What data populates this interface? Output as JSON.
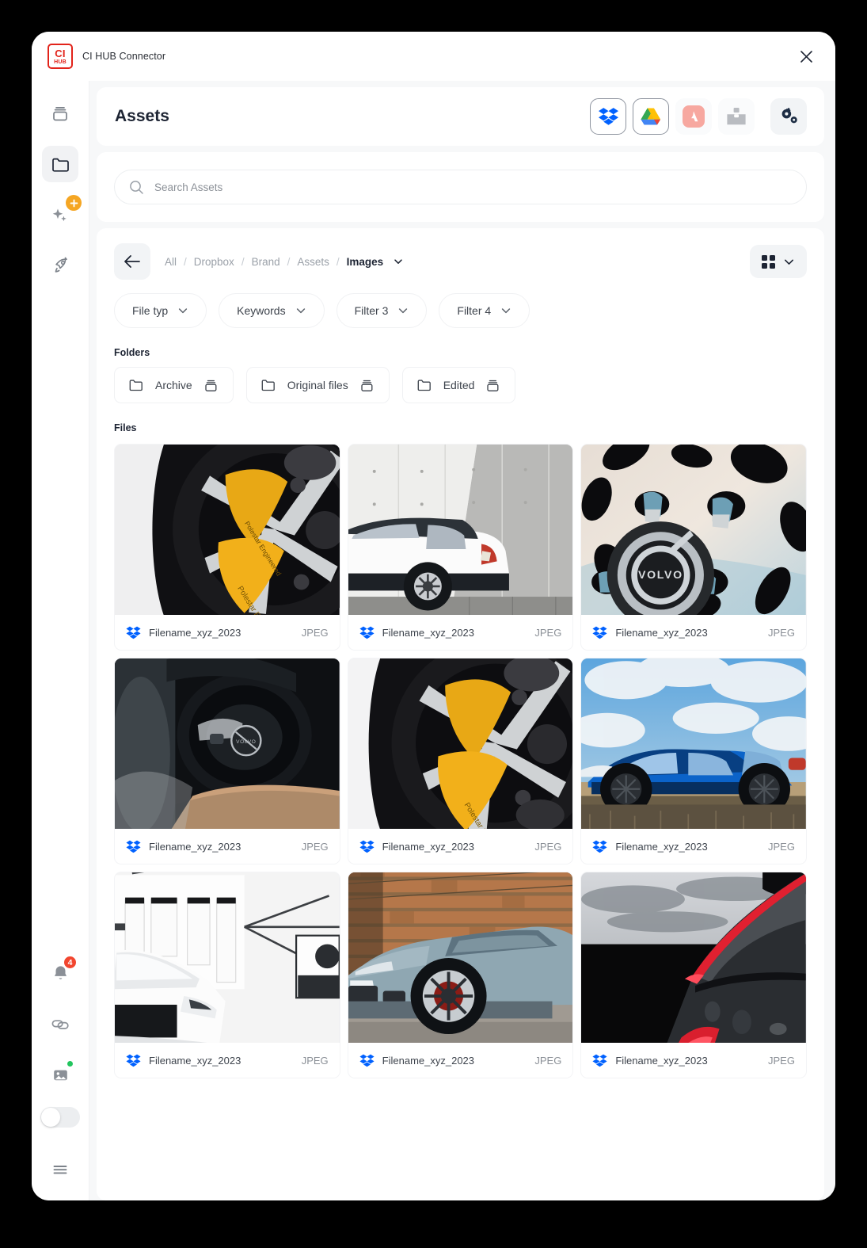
{
  "window": {
    "app_title": "CI HUB Connector",
    "logo_top": "CI",
    "logo_bottom": "HUB",
    "close_icon": "close-icon"
  },
  "sidebar": {
    "top_items": [
      {
        "name": "stack-icon",
        "label": "Stack",
        "active": false
      },
      {
        "name": "folder-icon",
        "label": "Folder",
        "active": true
      },
      {
        "name": "sparkles-icon",
        "label": "AI",
        "active": false,
        "badge": "plus"
      },
      {
        "name": "rocket-icon",
        "label": "Rocket",
        "active": false
      }
    ],
    "bottom_items": [
      {
        "name": "bell-icon",
        "label": "Notifications",
        "badge_count": "4"
      },
      {
        "name": "link-icon",
        "label": "Links"
      },
      {
        "name": "image-icon",
        "label": "Images",
        "badge": "dot"
      },
      {
        "name": "toggle-switch",
        "label": "Toggle",
        "state": "off"
      },
      {
        "name": "hamburger-icon",
        "label": "Menu"
      }
    ]
  },
  "header": {
    "title": "Assets",
    "connectors": [
      {
        "name": "dropbox-icon",
        "label": "Dropbox",
        "selected": true
      },
      {
        "name": "google-drive-icon",
        "label": "Google Drive",
        "selected": true
      },
      {
        "name": "adobe-icon",
        "label": "Adobe",
        "selected": false
      },
      {
        "name": "box-icon",
        "label": "Box",
        "selected": false
      }
    ],
    "settings_label": "Settings",
    "settings_icon": "gears-icon"
  },
  "search": {
    "placeholder": "Search Assets",
    "value": "",
    "icon": "search-icon"
  },
  "breadcrumb": {
    "back_icon": "arrow-left-icon",
    "separator": "/",
    "items": [
      {
        "label": "All",
        "current": false
      },
      {
        "label": "Dropbox",
        "current": false
      },
      {
        "label": "Brand",
        "current": false
      },
      {
        "label": "Assets",
        "current": false
      },
      {
        "label": "Images",
        "current": true
      }
    ],
    "dropdown_icon": "chevron-down-icon"
  },
  "view_mode": {
    "icon": "grid-view-icon",
    "chevron": "chevron-down-icon"
  },
  "filters": [
    {
      "label": "File typ",
      "icon": "chevron-down-icon"
    },
    {
      "label": "Keywords",
      "icon": "chevron-down-icon"
    },
    {
      "label": "Filter 3",
      "icon": "chevron-down-icon"
    },
    {
      "label": "Filter 4",
      "icon": "chevron-down-icon"
    }
  ],
  "folders": {
    "label": "Folders",
    "items": [
      {
        "label": "Archive",
        "left_icon": "folder-icon",
        "right_icon": "stack-icon"
      },
      {
        "label": "Original files",
        "left_icon": "folder-icon",
        "right_icon": "stack-icon"
      },
      {
        "label": "Edited",
        "left_icon": "folder-icon",
        "right_icon": "stack-icon"
      }
    ]
  },
  "files": {
    "label": "Files",
    "items": [
      {
        "name": "Filename_xyz_2023",
        "ext": "JPEG",
        "source_icon": "dropbox-icon",
        "thumb": "wheel-yellow-caliper"
      },
      {
        "name": "Filename_xyz_2023",
        "ext": "JPEG",
        "source_icon": "dropbox-icon",
        "thumb": "white-suv-concrete-wall"
      },
      {
        "name": "Filename_xyz_2023",
        "ext": "JPEG",
        "source_icon": "dropbox-icon",
        "thumb": "volvo-wheel-hub"
      },
      {
        "name": "Filename_xyz_2023",
        "ext": "JPEG",
        "source_icon": "dropbox-icon",
        "thumb": "steering-wheel-interior"
      },
      {
        "name": "Filename_xyz_2023",
        "ext": "JPEG",
        "source_icon": "dropbox-icon",
        "thumb": "wheel-yellow-caliper-2"
      },
      {
        "name": "Filename_xyz_2023",
        "ext": "JPEG",
        "source_icon": "dropbox-icon",
        "thumb": "blue-suv-field"
      },
      {
        "name": "Filename_xyz_2023",
        "ext": "JPEG",
        "source_icon": "dropbox-icon",
        "thumb": "white-car-studio"
      },
      {
        "name": "Filename_xyz_2023",
        "ext": "JPEG",
        "source_icon": "dropbox-icon",
        "thumb": "gray-sedan-brick-wall"
      },
      {
        "name": "Filename_xyz_2023",
        "ext": "JPEG",
        "source_icon": "dropbox-icon",
        "thumb": "dark-car-taillight"
      }
    ]
  },
  "colors": {
    "brand_red": "#e2231a",
    "dropbox_blue": "#0061ff",
    "accent_orange": "#f5a623",
    "badge_red": "#f2462f",
    "status_green": "#22c55e",
    "text_dark": "#1d2433",
    "text_muted": "#9aa0a8",
    "panel_bg": "#f7f8f9"
  }
}
